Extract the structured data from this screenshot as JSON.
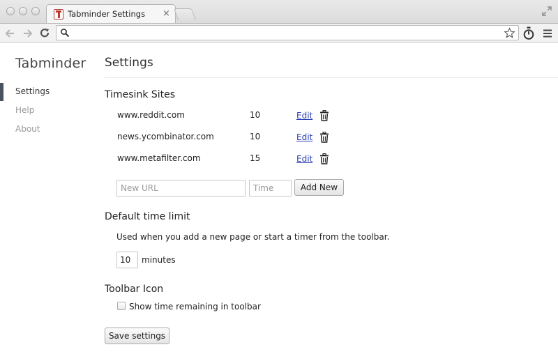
{
  "browser": {
    "tab_title": "Tabminder Settings",
    "tab_close": "×",
    "address": "",
    "icons": {
      "back": "arrow-left-icon",
      "forward": "arrow-right-icon",
      "reload": "reload-icon",
      "search": "search-icon",
      "bookmark": "star-icon",
      "extension": "stopwatch-icon",
      "menu": "hamburger-icon",
      "fullscreen": "fullscreen-icon"
    }
  },
  "sidebar": {
    "brand": "Tabminder",
    "items": [
      {
        "label": "Settings",
        "active": true
      },
      {
        "label": "Help",
        "active": false
      },
      {
        "label": "About",
        "active": false
      }
    ]
  },
  "main": {
    "title": "Settings",
    "timesink": {
      "heading": "Timesink Sites",
      "sites": [
        {
          "url": "www.reddit.com",
          "time": "10",
          "edit_label": "Edit"
        },
        {
          "url": "news.ycombinator.com",
          "time": "10",
          "edit_label": "Edit"
        },
        {
          "url": "www.metafilter.com",
          "time": "15",
          "edit_label": "Edit"
        }
      ],
      "new_url_placeholder": "New URL",
      "time_placeholder": "Time",
      "add_label": "Add New"
    },
    "default_limit": {
      "heading": "Default time limit",
      "description": "Used when you add a new page or start a timer from the toolbar.",
      "value": "10",
      "unit": "minutes"
    },
    "toolbar_icon": {
      "heading": "Toolbar Icon",
      "checkbox_label": "Show time remaining in toolbar",
      "checked": false
    },
    "save_label": "Save settings"
  },
  "colors": {
    "link": "#2a3fb8",
    "nav_marker": "#4a5260",
    "muted_nav": "#999999"
  }
}
